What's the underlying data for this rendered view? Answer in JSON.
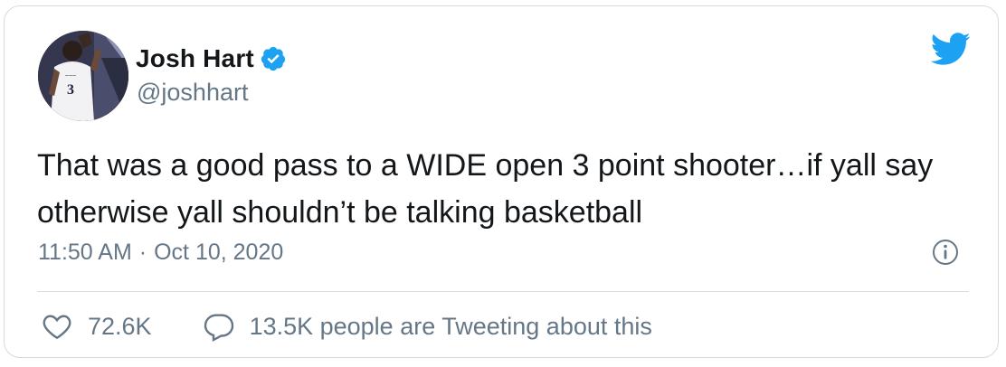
{
  "tweet": {
    "author": {
      "display_name": "Josh Hart",
      "handle": "@joshhart",
      "verified": true,
      "avatar_icon": "player-avatar",
      "jersey_number": "3"
    },
    "text": "That was a good pass to a WIDE open 3 point shooter…if yall say otherwise yall shouldn’t be talking basketball",
    "time": "11:50 AM",
    "separator": "·",
    "date": "Oct 10, 2020",
    "likes": "72.6K",
    "conversation": "13.5K people are Tweeting about this"
  },
  "colors": {
    "twitter_blue": "#1da1f2",
    "text_primary": "#14171a",
    "text_secondary": "#657786",
    "border": "#d4dbe1"
  },
  "icons": {
    "brand": "twitter-bird-icon",
    "verified": "verified-badge-icon",
    "info": "info-icon",
    "like": "heart-icon",
    "reply": "speech-bubble-icon"
  }
}
